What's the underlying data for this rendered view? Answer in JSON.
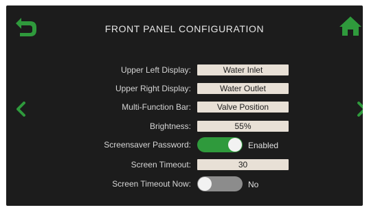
{
  "header": {
    "title": "FRONT PANEL CONFIGURATION"
  },
  "icons": {
    "back": "back-arrow-icon",
    "home": "home-icon",
    "prev": "chevron-left-icon",
    "next": "chevron-right-icon"
  },
  "colors": {
    "background": "#1c1c1c",
    "accent_green": "#2f9a3c",
    "field_background": "#e8e0d6",
    "toggle_off": "#8c8c8c"
  },
  "settings": {
    "upper_left_display": {
      "label": "Upper Left Display:",
      "value": "Water Inlet"
    },
    "upper_right_display": {
      "label": "Upper Right Display:",
      "value": "Water Outlet"
    },
    "multi_function_bar": {
      "label": "Multi-Function Bar:",
      "value": "Valve Position"
    },
    "brightness": {
      "label": "Brightness:",
      "value": "55%"
    },
    "screensaver_password": {
      "label": "Screensaver Password:",
      "state": "Enabled",
      "on": true
    },
    "screen_timeout": {
      "label": "Screen Timeout:",
      "value": "30"
    },
    "screen_timeout_now": {
      "label": "Screen Timeout Now:",
      "state": "No",
      "on": false
    }
  }
}
